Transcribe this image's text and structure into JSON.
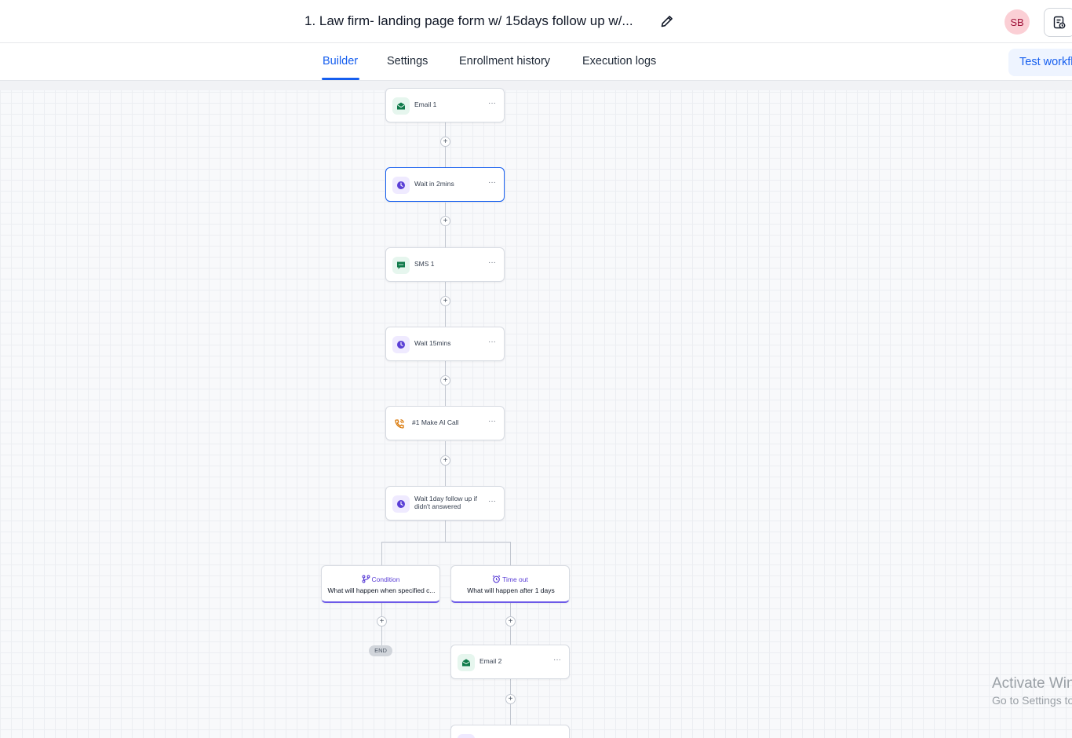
{
  "header": {
    "workflow_title": "1. Law firm- landing page form w/ 15days follow up w/...",
    "avatar_initials": "SB",
    "edit_icon": "pencil-icon",
    "notes_icon": "notes-icon"
  },
  "tabs": [
    {
      "label": "Builder",
      "active": true
    },
    {
      "label": "Settings",
      "active": false
    },
    {
      "label": "Enrollment history",
      "active": false
    },
    {
      "label": "Execution logs",
      "active": false
    }
  ],
  "test_button": {
    "label": "Test workflow"
  },
  "nodes": [
    {
      "label": "Email 1",
      "icon": "email-icon"
    },
    {
      "label": "Wait in 2mins",
      "icon": "clock-icon",
      "selected": true
    },
    {
      "label": "SMS 1",
      "icon": "sms-icon"
    },
    {
      "label": "Wait 15mins",
      "icon": "clock-icon"
    },
    {
      "label": "#1 Make AI Call",
      "icon": "phone-call-icon"
    },
    {
      "label": "Wait 1day follow up if didn't answered",
      "icon": "clock-icon"
    },
    {
      "label": "Email 2",
      "icon": "email-icon"
    }
  ],
  "node_menu_glyph": "···",
  "add_step_glyph": "+",
  "branches": [
    {
      "title": "Condition",
      "description": "What will happen when specified c...",
      "icon": "branch-icon"
    },
    {
      "title": "Time out",
      "description": "What will happen after 1 days",
      "icon": "alarm-clock-icon"
    }
  ],
  "end_label": "END",
  "watermark": {
    "line1": "Activate Windows",
    "line2": "Go to Settings to activate Windows."
  },
  "colors": {
    "accent": "#155eef",
    "branch_accent": "#6d5ae8",
    "email_green": "#0f7a4a",
    "wait_purple": "#5b3fd6",
    "call_orange": "#d97706"
  }
}
